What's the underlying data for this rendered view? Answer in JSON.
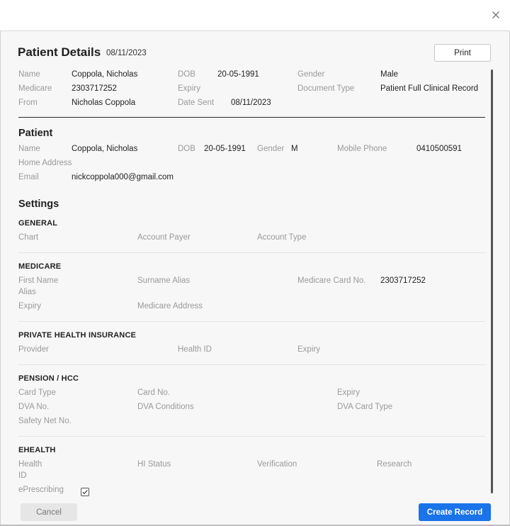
{
  "header": {
    "title": "Patient Details",
    "date": "08/11/2023",
    "print_label": "Print",
    "close_icon": "close-icon"
  },
  "document": {
    "name_label": "Name",
    "name_value": "Coppola, Nicholas",
    "dob_label": "DOB",
    "dob_value": "20-05-1991",
    "gender_label": "Gender",
    "gender_value": "Male",
    "medicare_label": "Medicare",
    "medicare_value": "2303717252",
    "expiry_label": "Expiry",
    "doctype_label": "Document Type",
    "doctype_value": "Patient Full Clinical Record",
    "from_label": "From",
    "from_value": "Nicholas Coppola",
    "datesent_label": "Date Sent",
    "datesent_value": "08/11/2023"
  },
  "patient": {
    "section_title": "Patient",
    "name_label": "Name",
    "name_value": "Coppola, Nicholas",
    "dob_label": "DOB",
    "dob_value": "20-05-1991",
    "gender_label": "Gender",
    "gender_value": "M",
    "mobile_label": "Mobile Phone",
    "mobile_value": "0410500591",
    "address_label": "Home Address",
    "email_label": "Email",
    "email_value": "nickcoppola000@gmail.com"
  },
  "settings": {
    "section_title": "Settings",
    "general": {
      "title": "GENERAL",
      "chart_label": "Chart",
      "payer_label": "Account Payer",
      "type_label": "Account Type"
    },
    "medicare": {
      "title": "MEDICARE",
      "firstname_label_1": "First Name",
      "firstname_label_2": "Alias",
      "surname_label": "Surname Alias",
      "cardno_label": "Medicare Card No.",
      "cardno_value": "2303717252",
      "expiry_label": "Expiry",
      "address_label": "Medicare Address"
    },
    "private_health": {
      "title": "PRIVATE HEALTH INSURANCE",
      "provider_label": "Provider",
      "healthid_label": "Health ID",
      "expiry_label": "Expiry"
    },
    "pension": {
      "title": "PENSION / HCC",
      "cardtype_label": "Card Type",
      "cardno_label": "Card No.",
      "expiry_label": "Expiry",
      "dvano_label": "DVA No.",
      "dvacond_label": "DVA Conditions",
      "dvacardtype_label": "DVA Card Type",
      "safetynet_label": "Safety Net No."
    },
    "ehealth": {
      "title": "EHEALTH",
      "healthid_label_1": "Health",
      "healthid_label_2": "ID",
      "histatus_label": "HI Status",
      "verification_label": "Verification",
      "research_label": "Research",
      "eprescribing_label": "ePrescribing",
      "eprescribing_checked": true
    }
  },
  "footer": {
    "cancel_label": "Cancel",
    "create_label": "Create Record"
  },
  "colors": {
    "primary": "#1a73e8",
    "panel_bg": "#f7f7f7",
    "label_gray": "#9a9a9a"
  }
}
